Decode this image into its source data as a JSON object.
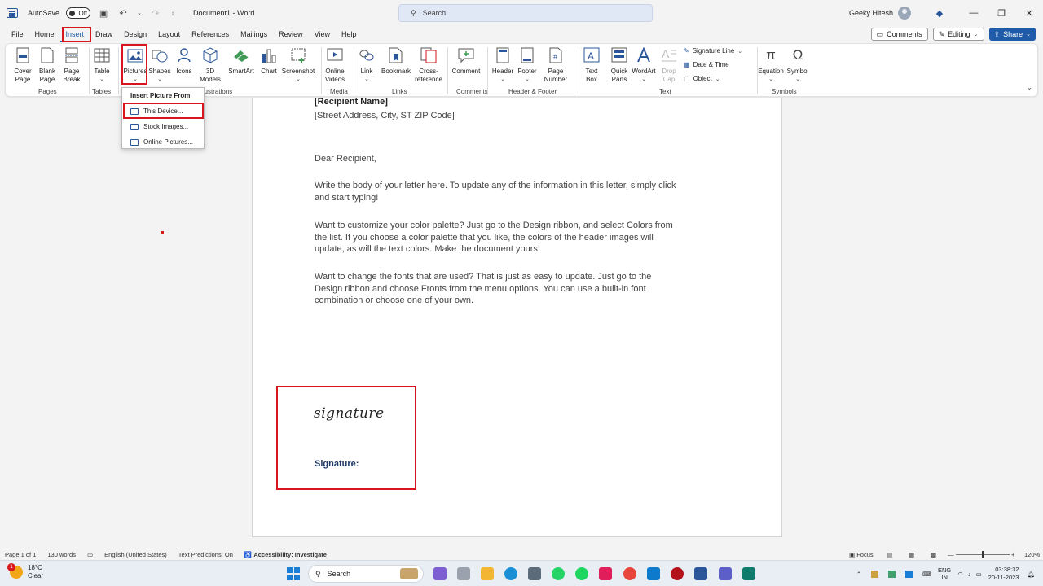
{
  "titlebar": {
    "autosave_label": "AutoSave",
    "autosave_state": "Off",
    "doc_title": "Document1 - Word",
    "search_placeholder": "Search",
    "user_name": "Geeky Hitesh"
  },
  "tabs": [
    "File",
    "Home",
    "Insert",
    "Draw",
    "Design",
    "Layout",
    "References",
    "Mailings",
    "Review",
    "View",
    "Help"
  ],
  "active_tab": "Insert",
  "menu_right": {
    "comments": "Comments",
    "editing": "Editing",
    "share": "Share"
  },
  "ribbon": {
    "cover_page": "Cover\nPage",
    "blank_page": "Blank\nPage",
    "page_break": "Page\nBreak",
    "table": "Table",
    "pictures": "Pictures",
    "shapes": "Shapes",
    "icons": "Icons",
    "models3d": "3D\nModels",
    "smartart": "SmartArt",
    "chart": "Chart",
    "screenshot": "Screenshot",
    "online_videos": "Online\nVideos",
    "link": "Link",
    "bookmark": "Bookmark",
    "cross_reference": "Cross-\nreference",
    "comment": "Comment",
    "header": "Header",
    "footer": "Footer",
    "page_number": "Page\nNumber",
    "text_box": "Text\nBox",
    "quick_parts": "Quick\nParts",
    "wordart": "WordArt",
    "drop_cap": "Drop\nCap",
    "signature_line": "Signature Line",
    "date_time": "Date & Time",
    "object": "Object",
    "equation": "Equation",
    "symbol": "Symbol",
    "groups": {
      "pages": "Pages",
      "tables": "Tables",
      "illustrations": "llustrations",
      "media": "Media",
      "links": "Links",
      "comments": "Comments",
      "header_footer": "Header & Footer",
      "text": "Text",
      "symbols": "Symbols"
    }
  },
  "dropdown": {
    "heading": "Insert Picture From",
    "items": [
      "This Device...",
      "Stock Images...",
      "Online Pictures..."
    ]
  },
  "document": {
    "recipient_name": "[Recipient Name]",
    "address": "[Street Address, City, ST ZIP Code]",
    "greeting": "Dear Recipient,",
    "p1_l1": "Write the body of your letter here.  To update any of the information in this letter, simply click",
    "p1_l2": "and start typing!",
    "p2_l1": "Want to customize your color palette?  Just go to the Design ribbon, and select Colors from",
    "p2_l2": "the list.  If you choose a color palette that you like, the colors of the header images will",
    "p2_l3": "update, as will the text colors.  Make the document yours!",
    "p3_l1": "Want to change the fonts that are used?  That is just as easy to update.  Just go to the",
    "p3_l2": "Design ribbon and choose Fronts from the menu options.  You can use a built-in font",
    "p3_l3": "combination or choose one of your own.",
    "signature_script": "signature",
    "signature_label": "Signature:"
  },
  "statusbar": {
    "page": "Page 1 of 1",
    "words": "130 words",
    "language": "English (United States)",
    "predictions": "Text Predictions: On",
    "accessibility": "Accessibility: Investigate",
    "focus": "Focus",
    "zoom": "120%"
  },
  "taskbar": {
    "temp": "18°C",
    "weather": "Clear",
    "weather_badge": "1",
    "search": "Search",
    "lang1": "ENG",
    "lang2": "IN",
    "time": "03:38:32",
    "date": "20-11-2023"
  },
  "colors": {
    "accent": "#1f5ba8",
    "highlight": "#d7161e"
  }
}
